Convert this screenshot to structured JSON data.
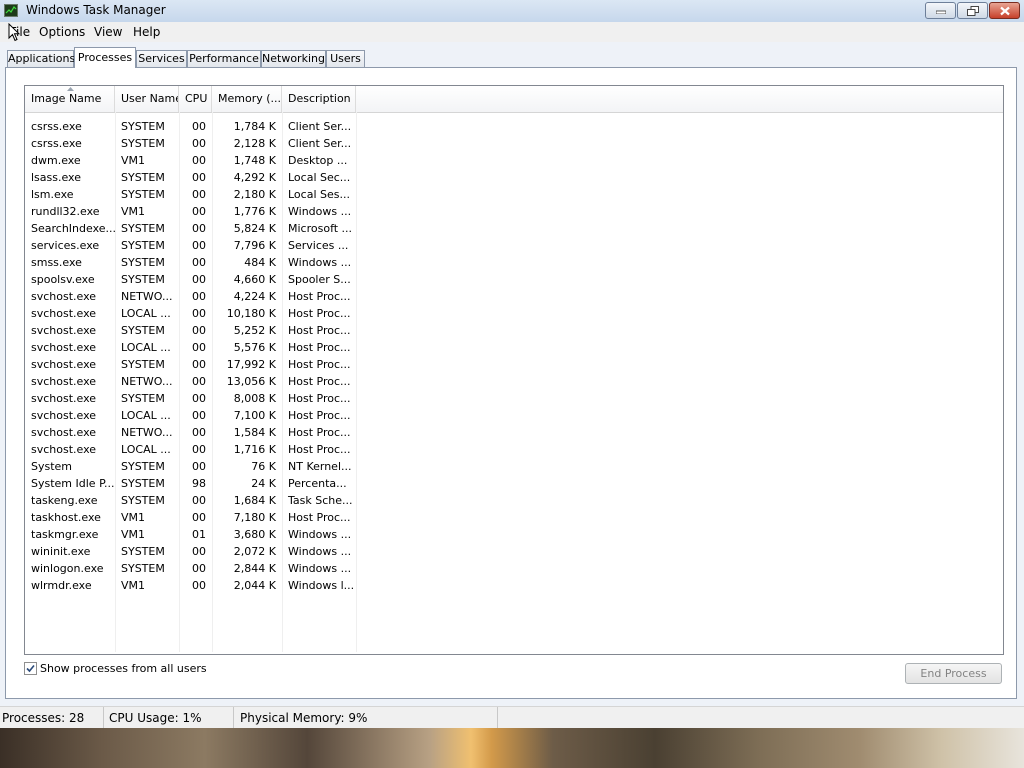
{
  "window": {
    "title": "Windows Task Manager"
  },
  "menu": {
    "items": [
      "File",
      "Options",
      "View",
      "Help"
    ]
  },
  "tabs": [
    {
      "label": "Applications",
      "active": false
    },
    {
      "label": "Processes",
      "active": true
    },
    {
      "label": "Services",
      "active": false
    },
    {
      "label": "Performance",
      "active": false
    },
    {
      "label": "Networking",
      "active": false
    },
    {
      "label": "Users",
      "active": false
    }
  ],
  "table": {
    "columns": [
      "Image Name",
      "User Name",
      "CPU",
      "Memory (...",
      "Description"
    ],
    "sort_column": "Image Name",
    "rows": [
      [
        "csrss.exe",
        "SYSTEM",
        "00",
        "1,784 K",
        "Client Ser..."
      ],
      [
        "csrss.exe",
        "SYSTEM",
        "00",
        "2,128 K",
        "Client Ser..."
      ],
      [
        "dwm.exe",
        "VM1",
        "00",
        "1,748 K",
        "Desktop ..."
      ],
      [
        "lsass.exe",
        "SYSTEM",
        "00",
        "4,292 K",
        "Local Sec..."
      ],
      [
        "lsm.exe",
        "SYSTEM",
        "00",
        "2,180 K",
        "Local Ses..."
      ],
      [
        "rundll32.exe",
        "VM1",
        "00",
        "1,776 K",
        "Windows ..."
      ],
      [
        "SearchIndexe...",
        "SYSTEM",
        "00",
        "5,824 K",
        "Microsoft ..."
      ],
      [
        "services.exe",
        "SYSTEM",
        "00",
        "7,796 K",
        "Services ..."
      ],
      [
        "smss.exe",
        "SYSTEM",
        "00",
        "484 K",
        "Windows ..."
      ],
      [
        "spoolsv.exe",
        "SYSTEM",
        "00",
        "4,660 K",
        "Spooler S..."
      ],
      [
        "svchost.exe",
        "NETWO...",
        "00",
        "4,224 K",
        "Host Proc..."
      ],
      [
        "svchost.exe",
        "LOCAL ...",
        "00",
        "10,180 K",
        "Host Proc..."
      ],
      [
        "svchost.exe",
        "SYSTEM",
        "00",
        "5,252 K",
        "Host Proc..."
      ],
      [
        "svchost.exe",
        "LOCAL ...",
        "00",
        "5,576 K",
        "Host Proc..."
      ],
      [
        "svchost.exe",
        "SYSTEM",
        "00",
        "17,992 K",
        "Host Proc..."
      ],
      [
        "svchost.exe",
        "NETWO...",
        "00",
        "13,056 K",
        "Host Proc..."
      ],
      [
        "svchost.exe",
        "SYSTEM",
        "00",
        "8,008 K",
        "Host Proc..."
      ],
      [
        "svchost.exe",
        "LOCAL ...",
        "00",
        "7,100 K",
        "Host Proc..."
      ],
      [
        "svchost.exe",
        "NETWO...",
        "00",
        "1,584 K",
        "Host Proc..."
      ],
      [
        "svchost.exe",
        "LOCAL ...",
        "00",
        "1,716 K",
        "Host Proc..."
      ],
      [
        "System",
        "SYSTEM",
        "00",
        "76 K",
        "NT Kernel..."
      ],
      [
        "System Idle P...",
        "SYSTEM",
        "98",
        "24 K",
        "Percenta..."
      ],
      [
        "taskeng.exe",
        "SYSTEM",
        "00",
        "1,684 K",
        "Task Sche..."
      ],
      [
        "taskhost.exe",
        "VM1",
        "00",
        "7,180 K",
        "Host Proc..."
      ],
      [
        "taskmgr.exe",
        "VM1",
        "01",
        "3,680 K",
        "Windows ..."
      ],
      [
        "wininit.exe",
        "SYSTEM",
        "00",
        "2,072 K",
        "Windows ..."
      ],
      [
        "winlogon.exe",
        "SYSTEM",
        "00",
        "2,844 K",
        "Windows ..."
      ],
      [
        "wlrmdr.exe",
        "VM1",
        "00",
        "2,044 K",
        "Windows l..."
      ]
    ]
  },
  "show_all_users": {
    "label": "Show processes from all users",
    "checked": true
  },
  "end_process": {
    "label": "End Process",
    "enabled": false
  },
  "status": {
    "processes": "Processes: 28",
    "cpu": "CPU Usage: 1%",
    "memory": "Physical Memory: 9%"
  }
}
